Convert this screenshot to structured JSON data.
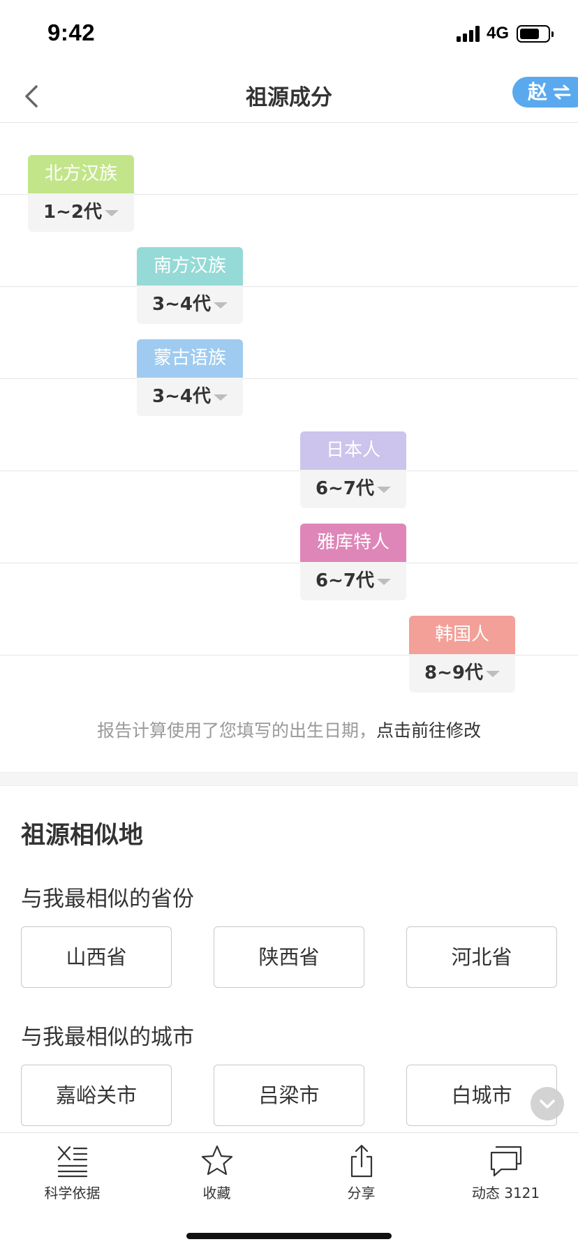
{
  "status_bar": {
    "time": "9:42",
    "network": "4G",
    "battery_percent": 75
  },
  "nav": {
    "title": "祖源成分",
    "surname": "赵",
    "back_icon": "chevron-left-icon",
    "swap_icon": "swap-arrows-icon"
  },
  "ancestry": [
    {
      "label": "北方汉族",
      "generation": "1~2代",
      "color": "#c2e58a"
    },
    {
      "label": "南方汉族",
      "generation": "3~4代",
      "color": "#95dad6"
    },
    {
      "label": "蒙古语族",
      "generation": "3~4代",
      "color": "#9fcbf0"
    },
    {
      "label": "日本人",
      "generation": "6~7代",
      "color": "#ccc4ec"
    },
    {
      "label": "雅库特人",
      "generation": "6~7代",
      "color": "#df86b8"
    },
    {
      "label": "韩国人",
      "generation": "8~9代",
      "color": "#f2a098"
    }
  ],
  "note": {
    "text": "报告计算使用了您填写的出生日期，",
    "link": "点击前往修改"
  },
  "similar": {
    "title": "祖源相似地",
    "province_title": "与我最相似的省份",
    "provinces": [
      "山西省",
      "陕西省",
      "河北省"
    ],
    "city_title": "与我最相似的城市",
    "cities": [
      "嘉峪关市",
      "吕梁市",
      "白城市"
    ]
  },
  "tabbar": [
    {
      "label": "科学依据",
      "icon": "dna-list-icon"
    },
    {
      "label": "收藏",
      "icon": "star-icon"
    },
    {
      "label": "分享",
      "icon": "share-icon"
    },
    {
      "label": "动态 3121",
      "icon": "chat-bubbles-icon"
    }
  ]
}
